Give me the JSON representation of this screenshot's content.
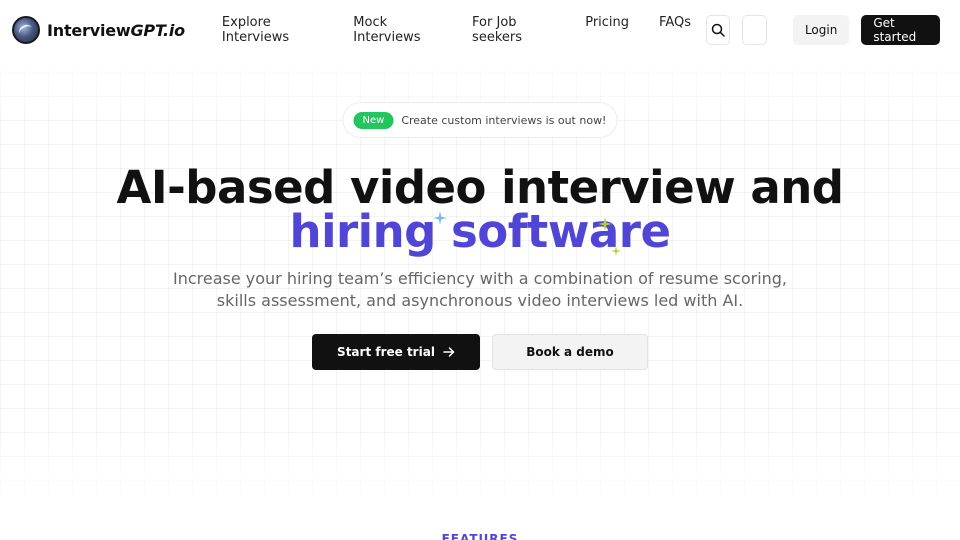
{
  "brand": {
    "name_plain": "Interview",
    "name_italic": "GPT.io"
  },
  "nav": {
    "links": [
      "Explore Interviews",
      "Mock Interviews",
      "For Job seekers",
      "Pricing",
      "FAQs"
    ],
    "login_label": "Login",
    "get_started_label": "Get started"
  },
  "hero": {
    "badge": "New",
    "announcement": "Create custom interviews is out now!",
    "title_line1": "AI-based video interview and",
    "title_line2": "hiring software",
    "subtitle_line1": "Increase your hiring team’s efficiency with a combination of resume scoring,",
    "subtitle_line2": "skills assessment, and asynchronous video interviews led with AI.",
    "primary_cta": "Start free trial",
    "secondary_cta": "Book a demo"
  },
  "features": {
    "label": "FEATURES"
  },
  "colors": {
    "accent": "#5145d6",
    "badge_green": "#22c55e",
    "dark": "#111111"
  },
  "icons": {
    "search": "search-icon",
    "arrow": "arrow-right-icon",
    "sparkle": "sparkle-icon"
  }
}
